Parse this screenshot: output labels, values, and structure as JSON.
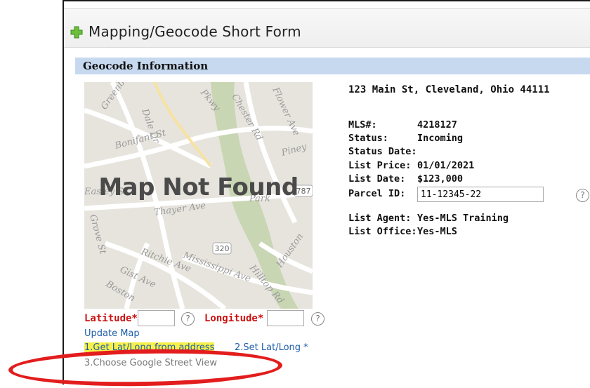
{
  "header": {
    "title": "Mapping/Geocode Short Form"
  },
  "section": {
    "title": "Geocode Information"
  },
  "map": {
    "overlay": "Map Not Found",
    "streets": [
      "Greenbrier",
      "Dale Dr",
      "Bonifant St",
      "Chester Rd",
      "Flower Ave",
      "Piney",
      "Thayer Ave",
      "Grove St",
      "Mississippi Ave",
      "Ritchie Ave",
      "Gist Ave",
      "Boston",
      "Hilltop Rd",
      "Houston",
      "Park",
      "Easley St",
      "Pkwy",
      "320",
      "787"
    ]
  },
  "property": {
    "address": "123 Main St, Cleveland, Ohio 44111",
    "mls_label": "MLS#:",
    "mls_value": "4218127",
    "status_label": "Status:",
    "status_value": "Incoming",
    "status_date_label": "Status Date:",
    "list_price_label": "List Price:",
    "list_price_value": "01/01/2021",
    "list_date_label": "List Date:",
    "list_date_value": "$123,000",
    "parcel_label": "Parcel ID:",
    "parcel_value": "11-12345-22",
    "agent_label": "List Agent:",
    "agent_value": "Yes-MLS Training",
    "office_label": "List Office:",
    "office_value": "Yes-MLS"
  },
  "geo": {
    "lat_label": "Latitude*",
    "lng_label": "Longitude*",
    "help": "?",
    "update_map": "Update Map",
    "step1": "1.Get Lat/Long from address",
    "step2": "2.Set Lat/Long *",
    "step3": "3.Choose Google Street View"
  },
  "colors": {
    "accent": "#1f5fa8",
    "required": "#cc1111",
    "section_bg": "#c7d9ef",
    "highlight": "#f8f04a",
    "annotation": "#e31d1d"
  }
}
